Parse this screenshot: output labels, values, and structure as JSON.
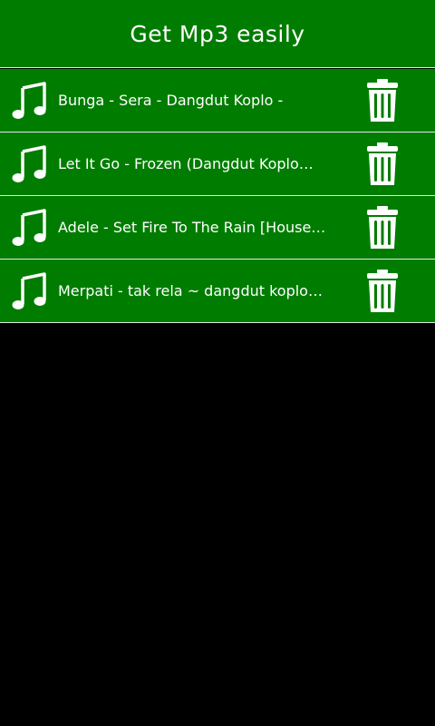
{
  "app": {
    "title": "Get Mp3 easily"
  },
  "colors": {
    "header_bg": "#007d00",
    "row_bg": "#007d00",
    "divider": "#e6e6e6",
    "background": "#000000",
    "text": "#ffffff"
  },
  "songs": [
    {
      "title": "Bunga - Sera - Dangdut Koplo -",
      "icon": "music-note-icon",
      "action_icon": "trash-icon"
    },
    {
      "title": "Let It Go - Frozen (Dangdut Koplo…",
      "icon": "music-note-icon",
      "action_icon": "trash-icon"
    },
    {
      "title": "Adele - Set Fire To The Rain [House…",
      "icon": "music-note-icon",
      "action_icon": "trash-icon"
    },
    {
      "title": "Merpati - tak rela ~ dangdut koplo…",
      "icon": "music-note-icon",
      "action_icon": "trash-icon"
    }
  ]
}
